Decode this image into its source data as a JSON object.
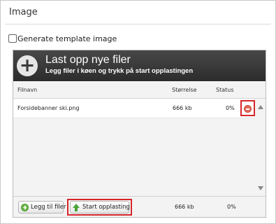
{
  "section": {
    "title": "Image"
  },
  "checkbox": {
    "label": "Generate template image",
    "checked": false
  },
  "uploader": {
    "title": "Last opp nye filer",
    "subtitle": "Legg filer i køen og trykk på start opplastingen",
    "columns": {
      "name": "Filnavn",
      "size": "Størrelse",
      "status": "Status"
    },
    "files": [
      {
        "name": "Forsidebanner ski.png",
        "size": "666 kb",
        "status": "0%"
      }
    ],
    "footer": {
      "add_label": "Legg til filer",
      "start_label": "Start opplasting",
      "total_size": "666 kb",
      "total_status": "0%"
    }
  },
  "icons": {
    "header": "plus-circle-icon",
    "remove": "remove-icon",
    "add": "add-icon",
    "start": "arrow-up-icon",
    "scroll_up": "scroll-up-icon",
    "scroll_down": "scroll-down-icon"
  },
  "colors": {
    "header_bg": "#3b3b3b",
    "highlight": "#d7262c",
    "add_green": "#6eb84a",
    "remove_red": "#e26b5d"
  }
}
